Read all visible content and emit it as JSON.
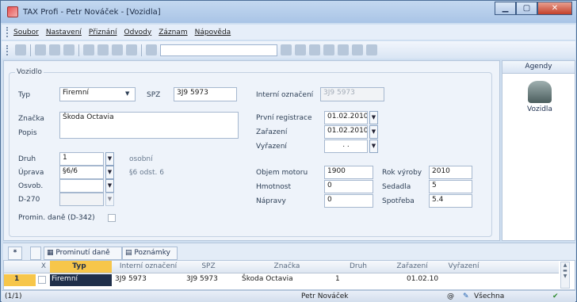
{
  "window": {
    "title": "TAX Profi - Petr Nováček - [Vozidla]",
    "min": "▁",
    "max": "▢",
    "close": "✕"
  },
  "menu": [
    "Soubor",
    "Nastavení",
    "Přiznání",
    "Odvody",
    "Záznam",
    "Nápověda"
  ],
  "form": {
    "group": "Vozidlo",
    "typ_label": "Typ",
    "typ_value": "Firemní",
    "spz_label": "SPZ",
    "spz_value": "3J9 5973",
    "interni_label": "Interní označení",
    "interni_value": "3J9 5973",
    "znacka_label": "Značka",
    "znacka_value": "Škoda Octavia",
    "popis_label": "Popis",
    "druh_label": "Druh",
    "druh_value": "1",
    "druh_desc": "osobní",
    "uprava_label": "Úprava",
    "uprava_value": "§6/6",
    "uprava_desc": "§6 odst. 6",
    "osvob_label": "Osvob.",
    "d270_label": "D-270",
    "promin_label": "Promin. daně (D-342)",
    "prvni_label": "První registrace",
    "prvni_value": "01.02.2010",
    "zarazeni_label": "Zařazení",
    "zarazeni_value": "01.02.2010",
    "vyrazeni_label": "Vyřazení",
    "vyrazeni_value": ". .",
    "objem_label": "Objem motoru",
    "objem_value": "1900",
    "hmotnost_label": "Hmotnost",
    "hmotnost_value": "0",
    "napravy_label": "Nápravy",
    "napravy_value": "0",
    "rok_label": "Rok výroby",
    "rok_value": "2010",
    "sedadla_label": "Sedadla",
    "sedadla_value": "5",
    "spotreba_label": "Spotřeba",
    "spotreba_value": "5.4"
  },
  "agendy": {
    "header": "Agendy",
    "item": "Vozidla"
  },
  "tabs": {
    "star": "*",
    "prominuti": "Prominutí daně",
    "poznamky": "Poznámky"
  },
  "grid": {
    "headers": [
      "X",
      "Typ",
      "Interní označení",
      "SPZ",
      "Značka",
      "Druh",
      "Zařazení",
      "Vyřazení"
    ],
    "row": {
      "num": "1",
      "typ": "Firemní",
      "interni": "3J9 5973",
      "spz": "3J9 5973",
      "znacka": "Škoda Octavia",
      "druh": "1",
      "zarazeni": "01.02.10",
      "vyrazeni": ""
    }
  },
  "status": {
    "count": "(1/1)",
    "user": "Petr Nováček",
    "at": "@",
    "filter": "Všechna",
    "ok": "✔"
  },
  "colors": {
    "accent": "#1f2f4a",
    "selected_header": "#f7c64a",
    "title_gradient": "#a9c4e6"
  }
}
